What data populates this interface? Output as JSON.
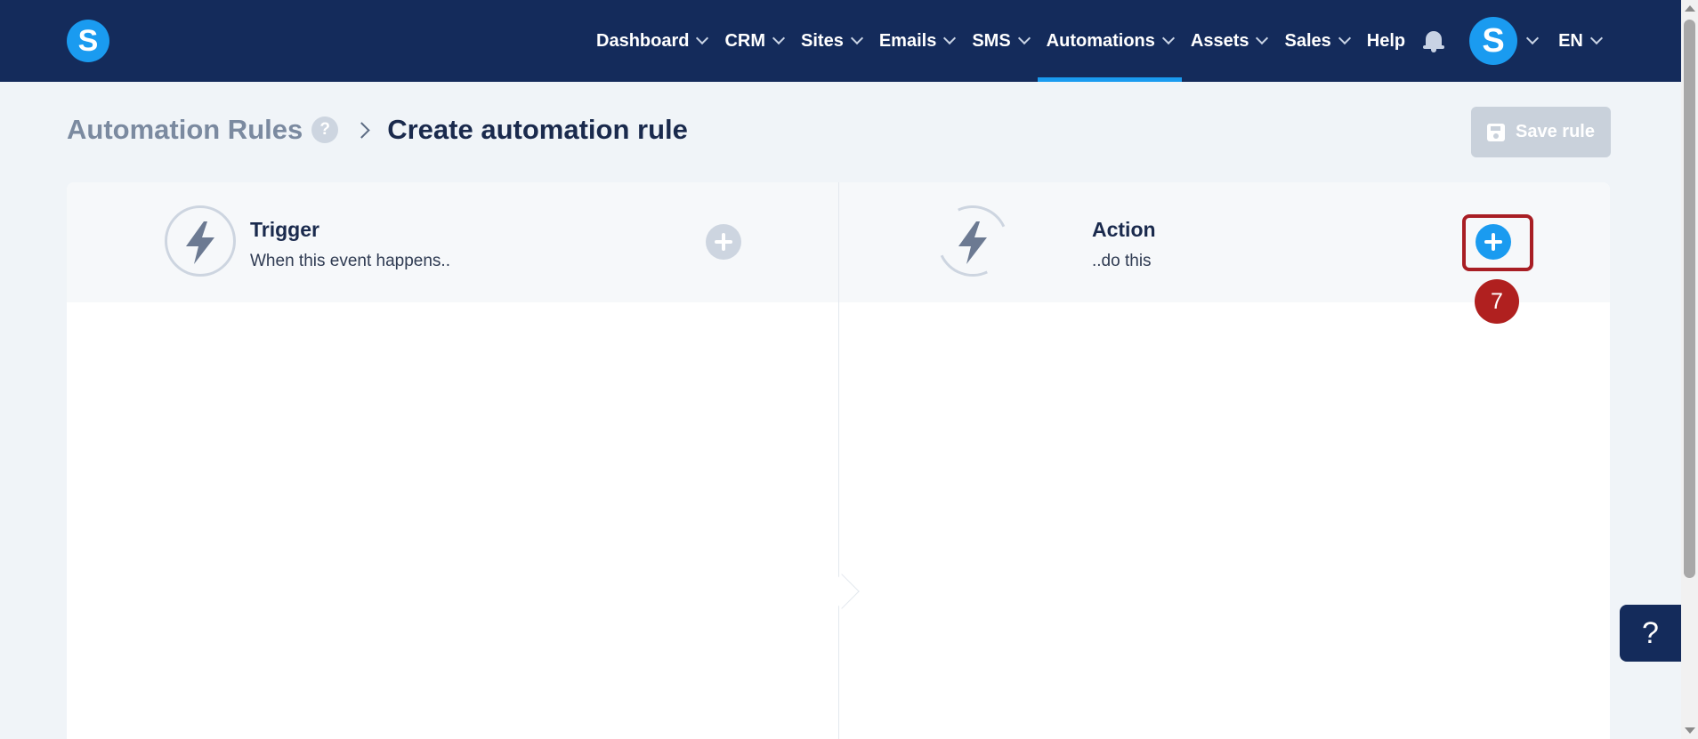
{
  "brand": {
    "logo_letter": "S"
  },
  "nav": {
    "items": [
      {
        "label": "Dashboard",
        "has_menu": true,
        "active": false
      },
      {
        "label": "CRM",
        "has_menu": true,
        "active": false
      },
      {
        "label": "Sites",
        "has_menu": true,
        "active": false
      },
      {
        "label": "Emails",
        "has_menu": true,
        "active": false
      },
      {
        "label": "SMS",
        "has_menu": true,
        "active": false
      },
      {
        "label": "Automations",
        "has_menu": true,
        "active": true
      },
      {
        "label": "Assets",
        "has_menu": true,
        "active": false
      },
      {
        "label": "Sales",
        "has_menu": true,
        "active": false
      },
      {
        "label": "Help",
        "has_menu": false,
        "active": false
      }
    ],
    "avatar_letter": "S",
    "language": "EN"
  },
  "header": {
    "breadcrumb_parent": "Automation Rules",
    "help_mark": "?",
    "page_title": "Create automation rule",
    "save_label": "Save rule"
  },
  "trigger": {
    "title": "Trigger",
    "subtitle": "When this event happens.."
  },
  "action": {
    "title": "Action",
    "subtitle": "..do this"
  },
  "annotation": {
    "step_number": "7"
  },
  "help_widget": {
    "label": "?"
  },
  "colors": {
    "topbar": "#142b5b",
    "accent": "#1a9bf0",
    "highlight": "#a81e24",
    "disabled": "#c9d1db"
  }
}
